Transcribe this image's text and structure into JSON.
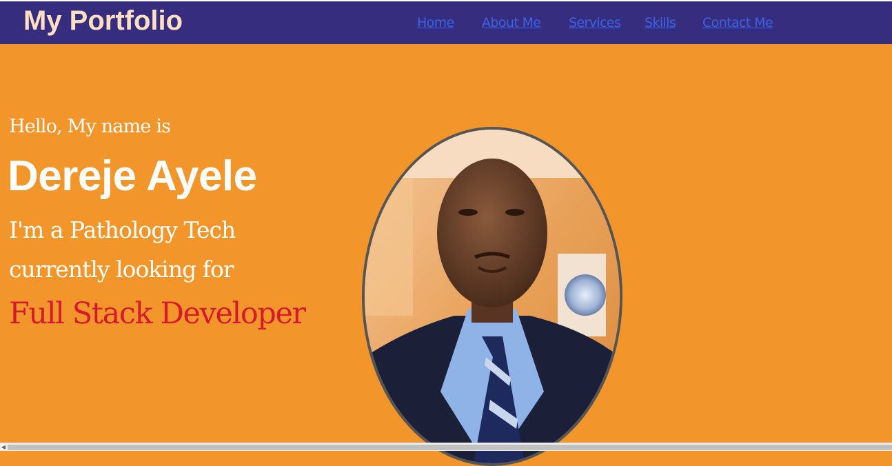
{
  "header": {
    "brand": "My Portfolio",
    "nav": [
      {
        "label": "Home"
      },
      {
        "label": "About Me"
      },
      {
        "label": "Services"
      },
      {
        "label": "Skills"
      },
      {
        "label": "Contact Me"
      }
    ]
  },
  "hero": {
    "greeting": "Hello, My name is",
    "name": "Dereje Ayele",
    "line1": "I'm a Pathology Tech",
    "line2": "currently looking for",
    "role": "Full Stack Developer"
  },
  "colors": {
    "header_bg": "#372d7f",
    "brand_text": "#fde0c2",
    "nav_link": "#3a62e8",
    "hero_bg": "#f2962c",
    "role_text": "#d61a2e",
    "photo_border": "#555555"
  },
  "scrollbar": {
    "left_arrow_icon": "chevron-left-icon"
  }
}
